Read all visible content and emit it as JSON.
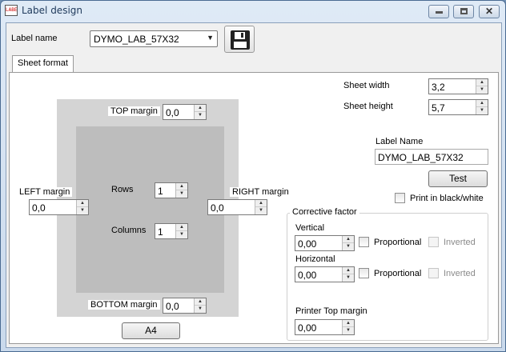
{
  "window": {
    "title": "Label design",
    "app_icon_text": "LABEL",
    "controls": {
      "minimize": "minimize-icon",
      "maximize": "maximize-icon",
      "close": "close-icon"
    }
  },
  "header": {
    "label_name_label": "Label name",
    "label_name_value": "DYMO_LAB_57X32",
    "dropdown_arrow": "▼",
    "save_icon": "floppy-disk-icon"
  },
  "tabs": [
    {
      "label": "Sheet format",
      "selected": true
    }
  ],
  "layout": {
    "top_margin_label": "TOP margin",
    "top_margin_value": "0,0",
    "left_margin_label": "LEFT margin",
    "left_margin_value": "0,0",
    "right_margin_label": "RIGHT margin",
    "right_margin_value": "0,0",
    "bottom_margin_label": "BOTTOM margin",
    "bottom_margin_value": "0,0",
    "rows_label": "Rows",
    "rows_value": "1",
    "columns_label": "Columns",
    "columns_value": "1",
    "paper_button": "A4"
  },
  "sheet": {
    "width_label": "Sheet width",
    "width_value": "3,2",
    "height_label": "Sheet height",
    "height_value": "5,7"
  },
  "label": {
    "name_label": "Label Name",
    "name_value": "DYMO_LAB_57X32",
    "test_button": "Test",
    "print_bw_label": "Print in black/white",
    "print_bw_checked": false
  },
  "corrective": {
    "title": "Corrective factor",
    "vertical_label": "Vertical",
    "vertical_value": "0,00",
    "vertical_proportional": "Proportional",
    "vertical_inverted": "Inverted",
    "horizontal_label": "Horizontal",
    "horizontal_value": "0,00",
    "horizontal_proportional": "Proportional",
    "horizontal_inverted": "Inverted",
    "printer_top_label": "Printer Top margin",
    "printer_top_value": "0,00"
  },
  "spin_glyphs": {
    "up": "▲",
    "down": "▼"
  }
}
